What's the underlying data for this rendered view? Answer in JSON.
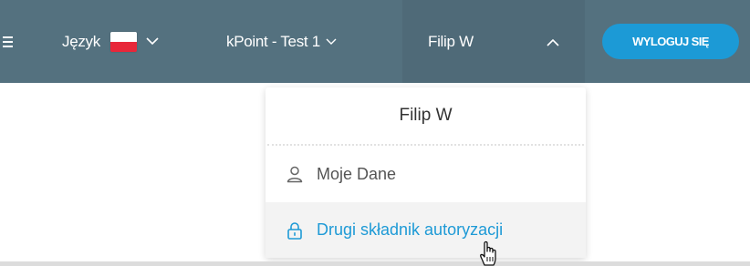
{
  "navbar": {
    "menu_icon": "hamburger-icon",
    "language_label": "Język",
    "language_flag": "poland-flag-icon",
    "project_label": "kPoint - Test 1",
    "user_label": "Filip W",
    "logout_label": "WYLOGUJ SIĘ",
    "colors": {
      "bar": "#54717f",
      "logout": "#1c9ad6"
    }
  },
  "user_menu": {
    "header": "Filip W",
    "items": [
      {
        "icon": "user-icon",
        "label": "Moje Dane"
      },
      {
        "icon": "lock-icon",
        "label": "Drugi składnik autoryzacji"
      }
    ],
    "accent": "#1e9ad6"
  }
}
